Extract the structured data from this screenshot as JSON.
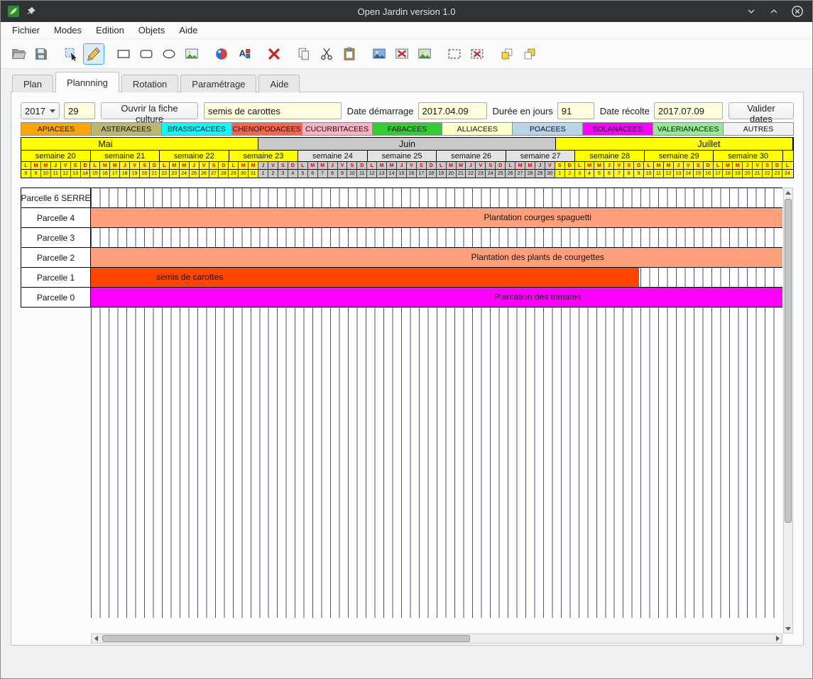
{
  "window": {
    "title": "Open Jardin version 1.0"
  },
  "menu": {
    "items": [
      "Fichier",
      "Modes",
      "Edition",
      "Objets",
      "Aide"
    ]
  },
  "toolbar": {
    "active": "pencil-icon",
    "groups": [
      [
        "open-icon",
        "save-icon"
      ],
      [
        "select-icon",
        "pencil-icon"
      ],
      [
        "rectangle-icon",
        "rounded-rectangle-icon",
        "ellipse-icon",
        "image-icon"
      ],
      [
        "color-ball-icon",
        "font-color-icon"
      ],
      [
        "delete-icon"
      ],
      [
        "copy-icon",
        "cut-icon",
        "paste-icon"
      ],
      [
        "image-export-icon",
        "image-delete-icon",
        "image-add-icon"
      ],
      [
        "selection-icon",
        "selection-delete-icon"
      ],
      [
        "raise-icon",
        "lower-icon"
      ]
    ]
  },
  "tabs": [
    {
      "label": "Plan",
      "active": false
    },
    {
      "label": "Plannning",
      "active": true
    },
    {
      "label": "Rotation",
      "active": false
    },
    {
      "label": "Paramétrage",
      "active": false
    },
    {
      "label": "Aide",
      "active": false
    }
  ],
  "controls": {
    "year": "2017",
    "week": "29",
    "open_fiche_label": "Ouvrir la fiche culture",
    "culture": "semis de carottes",
    "date_demarrage_label": "Date démarrage",
    "date_demarrage": "2017.04.09",
    "duree_label": "Durée en jours",
    "duree": "91",
    "date_recolte_label": "Date récolte",
    "date_recolte": "2017.07.09",
    "valider_label": "Valider dates"
  },
  "families": [
    {
      "label": "APIACEES",
      "color": "#FFA500"
    },
    {
      "label": "ASTERACEES",
      "color": "#BDB76B"
    },
    {
      "label": "BRASSICACEES",
      "color": "#00FFFF"
    },
    {
      "label": "CHENOPODACEES",
      "color": "#FF6347"
    },
    {
      "label": "CUCURBITACEES",
      "color": "#FFB0C0"
    },
    {
      "label": "FABACEES",
      "color": "#32CD32"
    },
    {
      "label": "ALLIACEES",
      "color": "#FFFFC8"
    },
    {
      "label": "POACEES",
      "color": "#B8D4EA"
    },
    {
      "label": "SOLANACEES",
      "color": "#FF00FF"
    },
    {
      "label": "VALERIANACEES",
      "color": "#90EE90"
    },
    {
      "label": "AUTRES",
      "color": "#F2F2F2"
    }
  ],
  "calendar": {
    "months": [
      {
        "label": "Mai",
        "days": 24,
        "color": "#FFFF00",
        "label_pct": 10.9
      },
      {
        "label": "Juin",
        "days": 30,
        "color": "#C9C9C9",
        "label_pct": 50.0
      },
      {
        "label": "Juillet",
        "days": 24,
        "color": "#FFFF00",
        "label_pct": 89.1
      }
    ],
    "weeks": [
      {
        "label": "semaine 20",
        "days": 7,
        "color": "#FFFF00"
      },
      {
        "label": "semaine 21",
        "days": 7,
        "color": "#FFFF00"
      },
      {
        "label": "semaine 22",
        "days": 7,
        "color": "#FFFF00"
      },
      {
        "label": "semaine 23",
        "days": 7,
        "color": "#FFFF00"
      },
      {
        "label": "semaine 24",
        "days": 7,
        "color": "#E3E3E3"
      },
      {
        "label": "semaine 25",
        "days": 7,
        "color": "#E3E3E3"
      },
      {
        "label": "semaine 26",
        "days": 7,
        "color": "#E3E3E3"
      },
      {
        "label": "semaine 27",
        "days": 7,
        "color": "#E3E3E3"
      },
      {
        "label": "semaine 28",
        "days": 7,
        "color": "#FFFF00"
      },
      {
        "label": "semaine 29",
        "days": 7,
        "color": "#FFFF00"
      },
      {
        "label": "semaine 30",
        "days": 7,
        "color": "#FFFF00"
      },
      {
        "label": "",
        "days": 1,
        "color": "#FFFF00"
      }
    ],
    "day_letters": [
      "L",
      "M",
      "M",
      "J",
      "V",
      "S",
      "D"
    ],
    "day_numbers": [
      8,
      9,
      10,
      11,
      12,
      13,
      14,
      15,
      16,
      17,
      18,
      19,
      20,
      21,
      22,
      23,
      24,
      25,
      26,
      27,
      28,
      29,
      30,
      31,
      1,
      2,
      3,
      4,
      5,
      6,
      7,
      8,
      9,
      10,
      11,
      12,
      13,
      14,
      15,
      16,
      17,
      18,
      19,
      20,
      21,
      22,
      23,
      24,
      25,
      26,
      27,
      28,
      29,
      30,
      1,
      2,
      3,
      4,
      5,
      6,
      7,
      8,
      9,
      10,
      11,
      12,
      13,
      14,
      15,
      16,
      17,
      18,
      19,
      20,
      21,
      22,
      23,
      24
    ]
  },
  "gantt": {
    "rows": [
      {
        "label": "Parcelle 6 SERRE",
        "bar": null
      },
      {
        "label": "Parcelle 4",
        "bar": {
          "text": "Plantation courges spaguetti",
          "color": "#FFA07A",
          "start_pct": 0,
          "width_pct": 100,
          "label_pct": 64.6
        }
      },
      {
        "label": "Parcelle 3",
        "bar": null
      },
      {
        "label": "Parcelle 2",
        "bar": {
          "text": "Plantation des plants de courgettes",
          "color": "#FFA07A",
          "start_pct": 0,
          "width_pct": 100,
          "label_pct": 64.6
        }
      },
      {
        "label": "Parcelle 1",
        "bar": {
          "text": "semis de carottes",
          "color": "#FF4500",
          "start_pct": 0,
          "width_pct": 79.3,
          "label_pct": 14.3
        }
      },
      {
        "label": "Parcelle 0",
        "bar": {
          "text": "Plantation des tomates",
          "color": "#FF00FF",
          "start_pct": 0,
          "width_pct": 100,
          "label_pct": 64.6
        }
      }
    ]
  }
}
